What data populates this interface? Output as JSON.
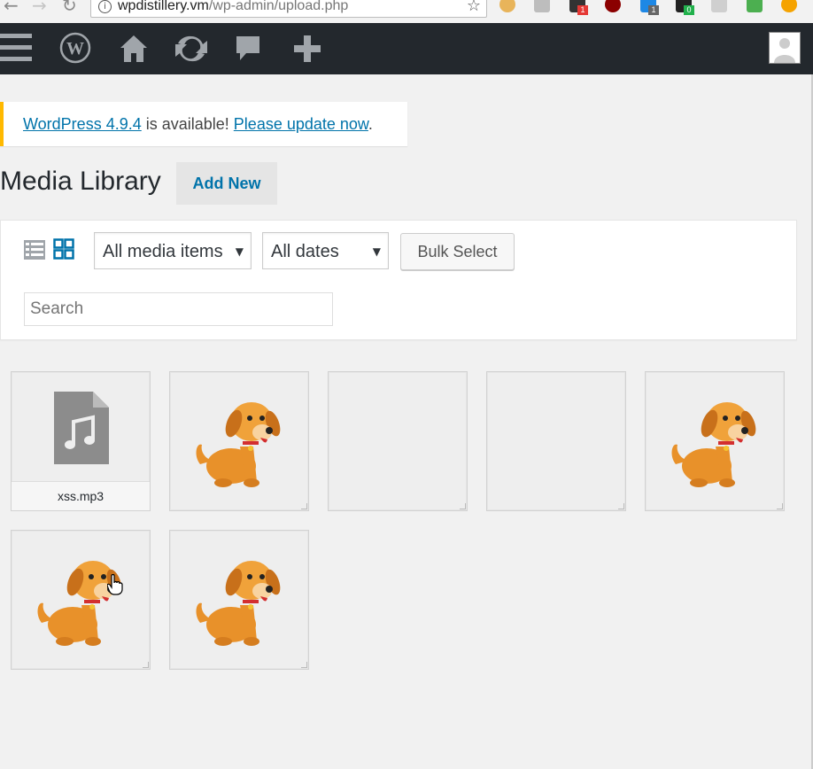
{
  "browser": {
    "url_host": "wpdistillery.vm",
    "url_path": "/wp-admin/upload.php",
    "extension_badges": [
      "1",
      "1",
      "0"
    ]
  },
  "admin_bar": {
    "icons": [
      "menu-icon",
      "wordpress-logo-icon",
      "home-icon",
      "updates-icon",
      "comments-icon",
      "new-content-icon",
      "avatar"
    ]
  },
  "notice": {
    "version_link": "WordPress 4.9.4",
    "middle_text": " is available! ",
    "update_link": "Please update now",
    "end_text": "."
  },
  "page": {
    "title": "Media Library",
    "add_new_label": "Add New"
  },
  "filters": {
    "media_type": "All media items",
    "dates": "All dates",
    "bulk_select_label": "Bulk Select",
    "search_placeholder": "Search"
  },
  "media_items": [
    {
      "type": "audio",
      "filename": "xss.mp3"
    },
    {
      "type": "image"
    },
    {
      "type": "blank"
    },
    {
      "type": "blank"
    },
    {
      "type": "image"
    },
    {
      "type": "image"
    },
    {
      "type": "image"
    }
  ],
  "colors": {
    "admin_bar": "#23282d",
    "link": "#0073aa",
    "notice_border": "#ffb900"
  }
}
